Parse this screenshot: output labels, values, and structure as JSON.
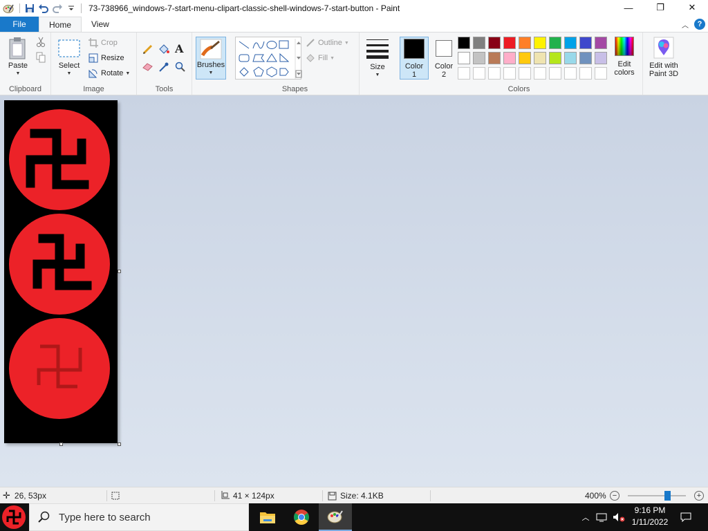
{
  "window": {
    "title": "73-738966_windows-7-start-menu-clipart-classic-shell-windows-7-start-button - Paint",
    "controls": {
      "minimize": "—",
      "maximize": "❐",
      "close": "✕"
    }
  },
  "tabs": {
    "file": "File",
    "home": "Home",
    "view": "View"
  },
  "ribbon": {
    "clipboard": {
      "label": "Clipboard",
      "paste": "Paste"
    },
    "image": {
      "label": "Image",
      "select": "Select",
      "crop": "Crop",
      "resize": "Resize",
      "rotate": "Rotate"
    },
    "tools": {
      "label": "Tools"
    },
    "brushes": {
      "label": "Brushes"
    },
    "shapes": {
      "label": "Shapes",
      "outline": "Outline",
      "fill": "Fill"
    },
    "size": {
      "label": "Size"
    },
    "colors": {
      "label": "Colors",
      "color1": "Color",
      "color1_num": "1",
      "color2": "Color",
      "color2_num": "2",
      "edit_colors": "Edit colors",
      "edit_paint3d": "Edit with Paint 3D",
      "palette_row1": [
        "#000000",
        "#7f7f7f",
        "#880015",
        "#ed1c24",
        "#ff7f27",
        "#fff200",
        "#22b14c",
        "#00a2e8",
        "#3f48cc",
        "#a349a4"
      ],
      "palette_row2": [
        "#ffffff",
        "#c3c3c3",
        "#b97a57",
        "#ffaec9",
        "#ffc90e",
        "#efe4b0",
        "#b5e61d",
        "#99d9ea",
        "#7092be",
        "#c8bfe7"
      ]
    }
  },
  "status": {
    "cursor_pos": "26, 53px",
    "image_size": "41 × 124px",
    "file_size": "Size: 4.1KB",
    "zoom": "400%"
  },
  "taskbar": {
    "search_placeholder": "Type here to search",
    "time": "9:16 PM",
    "date": "1/11/2022"
  }
}
